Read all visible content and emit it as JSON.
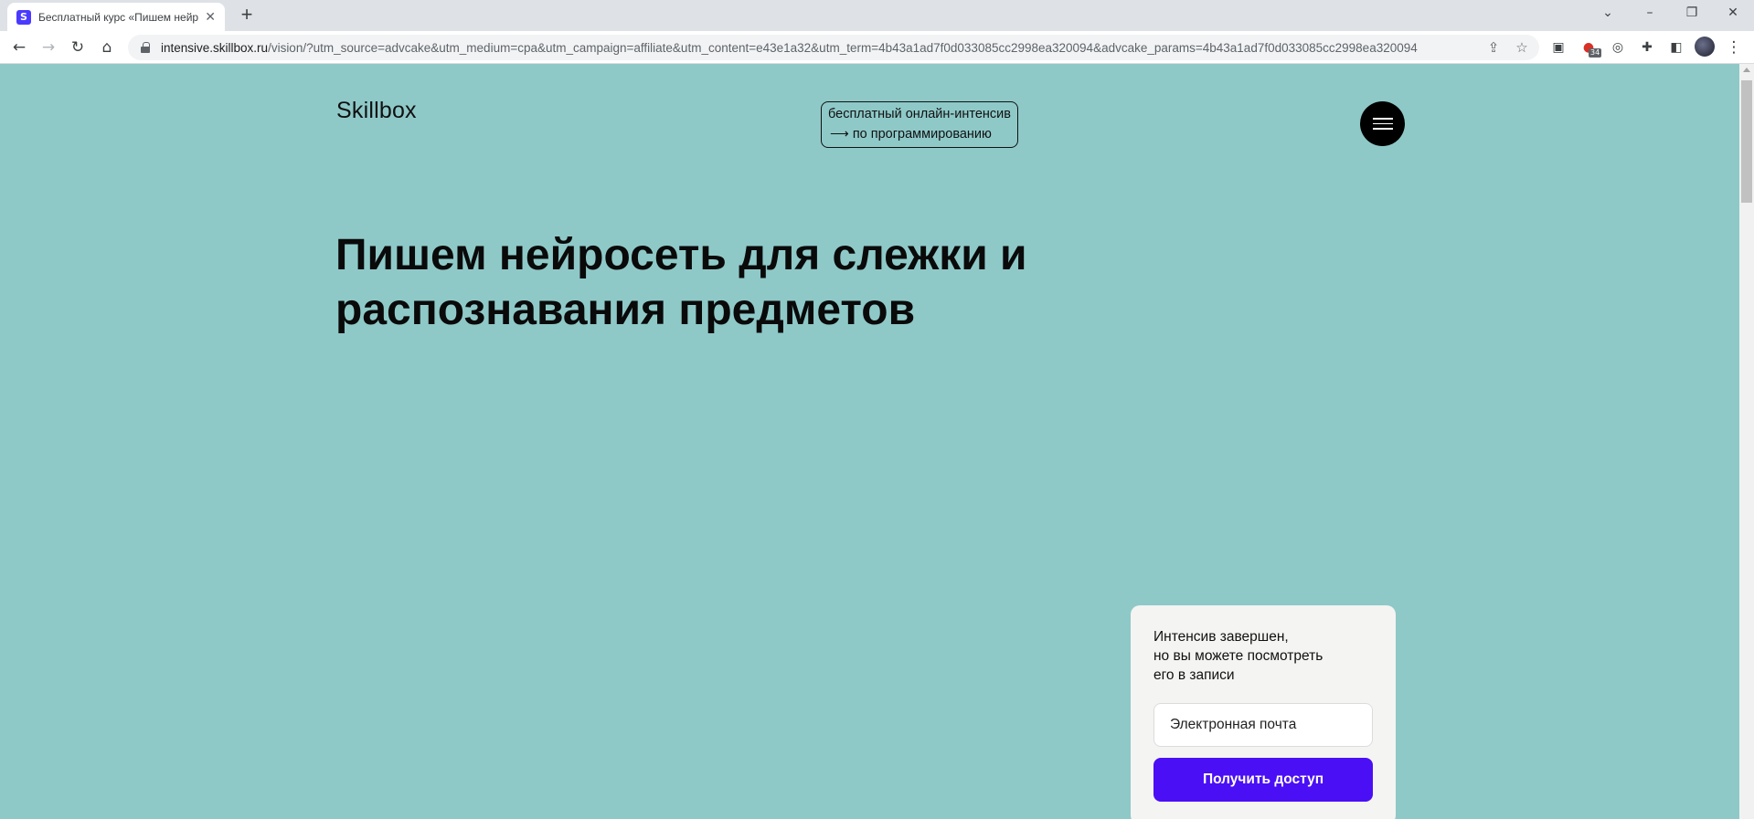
{
  "browser": {
    "tab_title": "Бесплатный курс «Пишем нейросеть для слежки и распознавания предметов»",
    "tab_favicon_letter": "S",
    "url_host": "intensive.skillbox.ru",
    "url_path": "/vision/?utm_source=advcake&utm_medium=cpa&utm_campaign=affiliate&utm_content=e43e1a32&utm_term=4b43a1ad7f0d033085cc2998ea320094&advcake_params=4b43a1ad7f0d033085cc2998ea320094",
    "extension_badge": "34"
  },
  "header": {
    "logo": "Skillbox",
    "tag_line1": "бесплатный онлайн-интенсив",
    "tag_line2": "⟶ по программированию"
  },
  "hero": {
    "title": "Пишем нейросеть для слежки и распознавания предметов"
  },
  "signup": {
    "text": "Интенсив завершен,\nно вы можете посмотреть\nего в записи",
    "email_placeholder": "Электронная почта",
    "button_label": "Получить доступ"
  },
  "colors": {
    "page_background": "#8ec9c8",
    "accent_button": "#4a0ff5",
    "card_background": "#f4f4f2"
  }
}
